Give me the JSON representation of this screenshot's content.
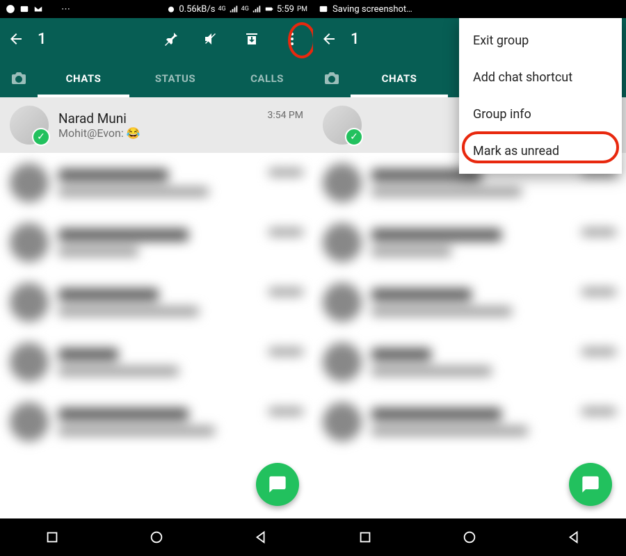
{
  "colors": {
    "brand": "#075E54",
    "accent": "#22c15e",
    "highlight": "#E8280E"
  },
  "left": {
    "status_bar": {
      "net_speed": "0.56kB/s",
      "net_label_a": "4G",
      "net_label_b": "4G",
      "time": "5:59",
      "ampm": "PM"
    },
    "toolbar": {
      "selected_count": "1"
    },
    "tabs": {
      "chats": "CHATS",
      "status": "STATUS",
      "calls": "CALLS"
    },
    "chat_selected": {
      "title": "Narad Muni",
      "subtitle": "Mohit@Evon: 😂",
      "time": "3:54 PM"
    }
  },
  "right": {
    "status_bar": {
      "title": "Saving screenshot…"
    },
    "toolbar": {
      "selected_count": "1"
    },
    "tabs": {
      "chats": "CHATS"
    },
    "menu": {
      "items": [
        "Exit group",
        "Add chat shortcut",
        "Group info",
        "Mark as unread"
      ],
      "highlighted_index": 3
    }
  }
}
